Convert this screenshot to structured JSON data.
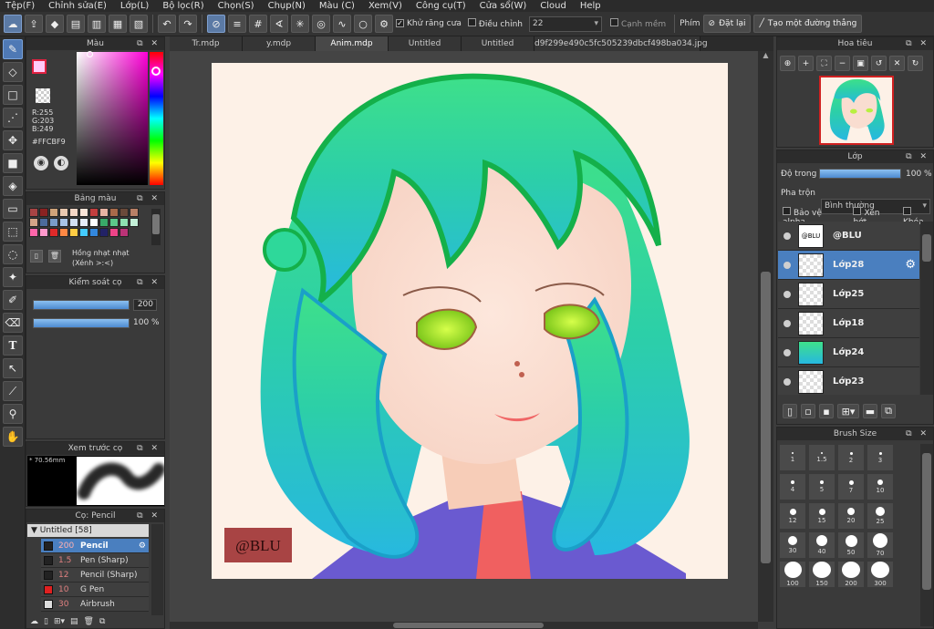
{
  "menu": [
    "Tệp(F)",
    "Chỉnh sửa(E)",
    "Lớp(L)",
    "Bộ lọc(R)",
    "Chọn(S)",
    "Chụp(N)",
    "Màu (C)",
    "Xem(V)",
    "Công cụ(T)",
    "Cửa sổ(W)",
    "Cloud",
    "Help"
  ],
  "toolbar": {
    "antialias_label": "Khử răng cưa",
    "correction_label": "Điều chỉnh",
    "correction_value": "22",
    "soft_edge_label": "Cạnh mềm",
    "key_label": "Phím",
    "reset_label": "Đặt lại",
    "straight_line_label": "Tạo một đường thẳng"
  },
  "color_panel": {
    "title": "Màu",
    "r": "R:255",
    "g": "G:203",
    "b": "B:249",
    "hex": "#FFCBF9",
    "current_color": "#FFCBF9"
  },
  "palette_panel": {
    "title": "Bảng màu",
    "label": "Hồng nhạt nhạt",
    "sublabel": "(Xénh >:<)",
    "swatches": [
      "#a84444",
      "#8a2222",
      "#cfa37a",
      "#e8c8b0",
      "#f4d7c7",
      "#fbe5d8",
      "#c23e3e",
      "#e7b3a3",
      "#a86a4a",
      "#6a4a3a",
      "#b88066",
      "#d4a488",
      "#4c6b9c",
      "#7a9cc8",
      "#a8c4e6",
      "#d2e0f2",
      "#e6eef8",
      "#ffffff",
      "#38a868",
      "#5cc88a",
      "#8ee0b0",
      "#c4f0d8",
      "#ff66aa",
      "#ff99cc",
      "#e02a2a",
      "#ff8844",
      "#ffcc44",
      "#44ccff",
      "#3388dd",
      "#222266",
      "#ee4488",
      "#bb3377"
    ]
  },
  "brush_control": {
    "title": "Kiểm soát cọ",
    "size_value": "200",
    "opacity_value": "100 %",
    "size_fraction": 1.0,
    "opacity_fraction": 1.0
  },
  "brush_preview": {
    "title": "Xem trước cọ",
    "size_text": "* 70.56mm"
  },
  "brush_list": {
    "title": "Cọ: Pencil",
    "group": "Untitled [58]",
    "items": [
      {
        "size": "200",
        "name": "Pencil",
        "color": "#222222",
        "selected": true
      },
      {
        "size": "1.5",
        "name": "Pen (Sharp)",
        "color": "#222222",
        "selected": false
      },
      {
        "size": "12",
        "name": "Pencil (Sharp)",
        "color": "#222222",
        "selected": false
      },
      {
        "size": "10",
        "name": "G Pen",
        "color": "#e02020",
        "selected": false
      },
      {
        "size": "30",
        "name": "Airbrush",
        "color": "#dddddd",
        "selected": false
      }
    ]
  },
  "tabs": [
    {
      "label": "Tr.mdp",
      "active": false
    },
    {
      "label": "y.mdp",
      "active": false
    },
    {
      "label": "Anim.mdp",
      "active": true
    },
    {
      "label": "Untitled",
      "active": false
    },
    {
      "label": "Untitled",
      "active": false
    },
    {
      "label": "d9f299e490c5fc505239dbcf498ba034.jpg",
      "active": false
    }
  ],
  "canvas": {
    "signature_text": "@BLU",
    "background_color": "#fdf0e6"
  },
  "navigator": {
    "title": "Hoa tiêu"
  },
  "layers_panel": {
    "title": "Lớp",
    "opacity_label": "Độ trong",
    "opacity_value": "100 %",
    "opacity_fraction": 1.0,
    "blend_label": "Pha trộn",
    "blend_value": "Bình thường",
    "protect_alpha": "Bảo vệ alpha",
    "clipping": "Xén bớt",
    "lock": "Khóa",
    "layers": [
      {
        "name": "@BLU",
        "selected": false,
        "thumb": "text"
      },
      {
        "name": "Lớp28",
        "selected": true,
        "thumb": "empty"
      },
      {
        "name": "Lớp25",
        "selected": false,
        "thumb": "empty"
      },
      {
        "name": "Lớp18",
        "selected": false,
        "thumb": "empty"
      },
      {
        "name": "Lớp24",
        "selected": false,
        "thumb": "teal"
      },
      {
        "name": "Lớp23",
        "selected": false,
        "thumb": "empty"
      }
    ]
  },
  "brush_size": {
    "title": "Brush Size",
    "sizes": [
      "1",
      "1.5",
      "2",
      "3",
      "4",
      "5",
      "7",
      "10",
      "12",
      "15",
      "20",
      "25",
      "30",
      "40",
      "50",
      "70",
      "100",
      "150",
      "200",
      "300"
    ]
  }
}
